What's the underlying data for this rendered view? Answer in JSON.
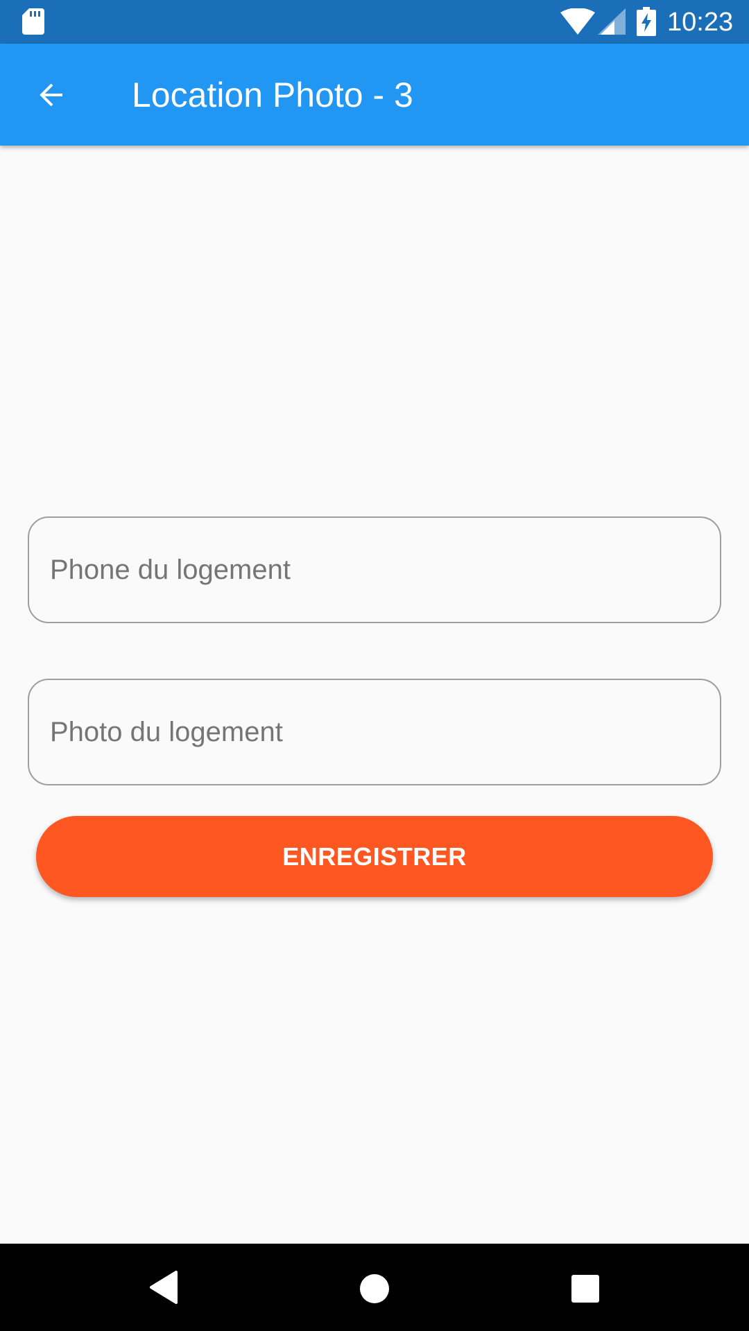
{
  "status_bar": {
    "time": "10:23",
    "icons": [
      "sd-card-icon",
      "wifi-icon",
      "signal-icon",
      "battery-charging-icon"
    ]
  },
  "app_bar": {
    "title": "Location Photo - 3",
    "back_icon": "arrow-back-icon",
    "color": "#2196f3"
  },
  "form": {
    "phone_field": {
      "placeholder": "Phone du logement",
      "value": ""
    },
    "photo_field": {
      "placeholder": "Photo du logement",
      "value": ""
    },
    "save_label": "ENREGISTRER",
    "save_color": "#ff5722"
  },
  "nav_bar": {
    "icons": [
      "nav-back-icon",
      "nav-home-icon",
      "nav-recents-icon"
    ]
  }
}
